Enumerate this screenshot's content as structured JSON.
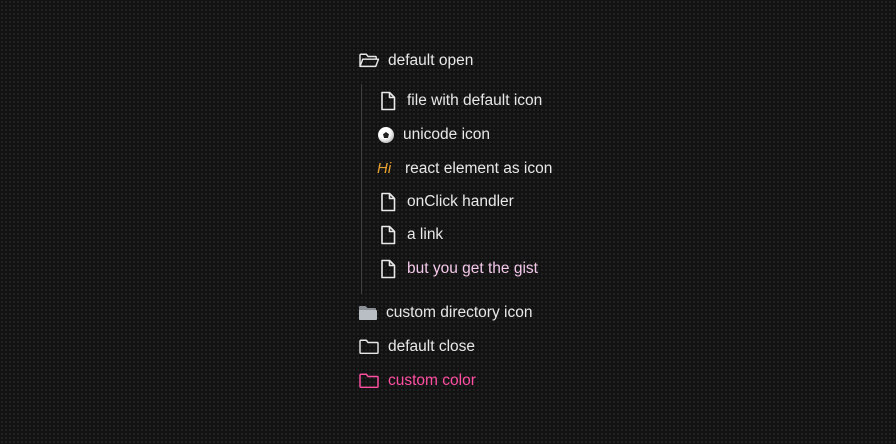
{
  "tree": {
    "default_open": {
      "label": "default open",
      "icon": "folder-open-icon"
    },
    "children": [
      {
        "label": "file with default icon",
        "icon": "file-icon"
      },
      {
        "label": "unicode icon",
        "icon": "soccer-ball-icon",
        "glyph": "⚽"
      },
      {
        "label": "react element as icon",
        "icon": "hi-text-icon",
        "icon_text": "Hi",
        "icon_color": "#e6a030"
      },
      {
        "label": "onClick handler",
        "icon": "file-icon"
      },
      {
        "label": "a link",
        "icon": "file-icon"
      },
      {
        "label": "but you get the gist",
        "icon": "file-icon",
        "color": "#f3c8ea"
      }
    ],
    "custom_directory": {
      "label": "custom directory icon",
      "icon": "folder-emoji-icon"
    },
    "default_close": {
      "label": "default close",
      "icon": "folder-closed-icon"
    },
    "custom_color": {
      "label": "custom color",
      "icon": "folder-closed-icon",
      "color": "#ff4fa3"
    }
  }
}
